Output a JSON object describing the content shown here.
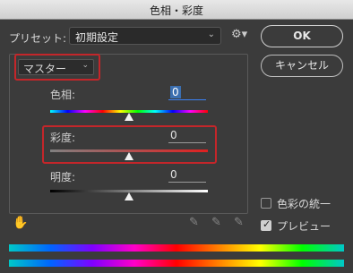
{
  "window": {
    "title": "色相・彩度"
  },
  "preset": {
    "label": "プリセット:",
    "value": "初期設定"
  },
  "buttons": {
    "ok": "OK",
    "cancel": "キャンセル"
  },
  "channel": {
    "value": "マスター"
  },
  "sliders": {
    "hue": {
      "label": "色相:",
      "value": "0",
      "position": 0.5
    },
    "saturation": {
      "label": "彩度:",
      "value": "0",
      "position": 0.5
    },
    "lightness": {
      "label": "明度:",
      "value": "0",
      "position": 0.5
    }
  },
  "options": {
    "colorize": "色彩の統一",
    "preview": "プレビュー"
  },
  "options_state": {
    "colorize": false,
    "preview": true
  },
  "icons": {
    "gear": "gear-icon",
    "hand": "hand-scrubby-icon",
    "eyedroppers": [
      "eyedropper-icon",
      "eyedropper-plus-icon",
      "eyedropper-minus-icon"
    ]
  }
}
